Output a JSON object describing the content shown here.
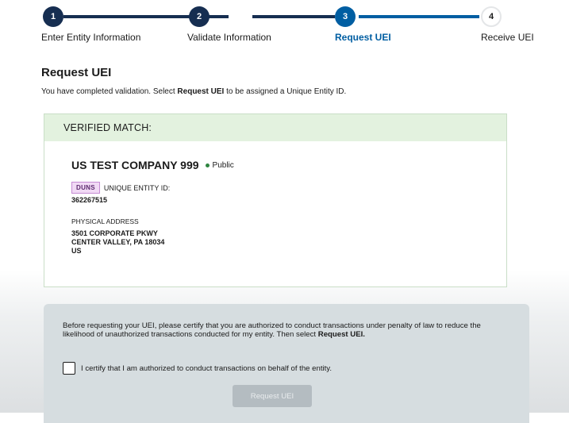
{
  "stepper": {
    "steps": [
      {
        "number": "1",
        "label": "Enter Entity Information"
      },
      {
        "number": "2",
        "label": "Validate Information"
      },
      {
        "number": "3",
        "label": "Request UEI"
      },
      {
        "number": "4",
        "label": "Receive UEI"
      }
    ],
    "current_step": 3
  },
  "page": {
    "title": "Request UEI",
    "intro_before": "You have completed validation. Select ",
    "intro_bold": "Request UEI",
    "intro_after": " to be assigned a Unique Entity ID."
  },
  "match": {
    "header": "VERIFIED MATCH:",
    "company_name": "US TEST COMPANY 999",
    "status": "Public",
    "id_badge": "DUNS",
    "id_label": "UNIQUE ENTITY ID:",
    "id_value": "362267515",
    "address_label": "PHYSICAL ADDRESS",
    "address_lines": [
      "3501 CORPORATE PKWY",
      "CENTER VALLEY, PA 18034",
      "US"
    ]
  },
  "certification": {
    "text_before": "Before requesting your UEI, please certify that you are authorized to conduct transactions under penalty of law to reduce the likelihood of unauthorized transactions conducted for my entity. Then select ",
    "text_bold": "Request UEI.",
    "checkbox_label": "I certify that I am authorized to conduct transactions on behalf of the entity.",
    "checkbox_checked": false,
    "button_label": "Request UEI"
  },
  "colors": {
    "step_complete": "#162e51",
    "step_current": "#005ea2",
    "verified_header_bg": "#e3f2df",
    "status_dot": "#2e8540",
    "badge_bg": "#f1d9f5",
    "button_disabled": "#b4bcc1"
  }
}
